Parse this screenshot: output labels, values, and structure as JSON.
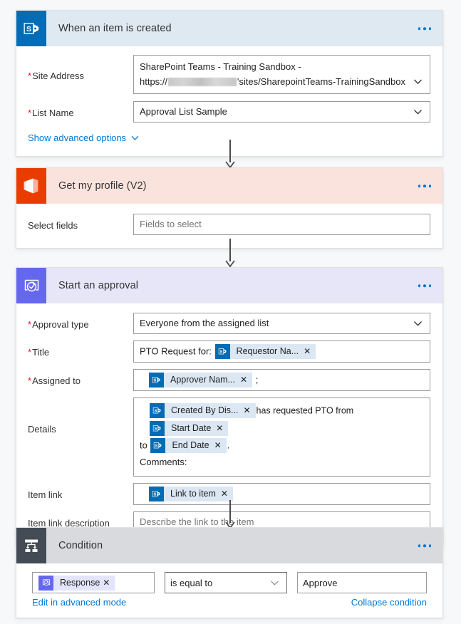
{
  "flow": {
    "steps": [
      {
        "id": "trigger-sharepoint",
        "title": "When an item is created",
        "connector": "SharePoint",
        "icon": "sharepoint-icon",
        "header_color": "#dfe9f2",
        "icon_color": "#036cb4",
        "menu": "more-options",
        "fields": [
          {
            "label": "Site Address",
            "required": true,
            "type": "dropdown",
            "value_line1": "SharePoint Teams - Training Sandbox -",
            "value_line2_prefix": "https://",
            "value_line2_redacted": true,
            "value_line2_suffix": "'sites/SharepointTeams-TrainingSandbox"
          },
          {
            "label": "List Name",
            "required": true,
            "type": "dropdown",
            "value": "Approval List Sample"
          }
        ],
        "advanced_link": "Show advanced options"
      },
      {
        "id": "get-my-profile",
        "title": "Get my profile (V2)",
        "connector": "Office 365 Users",
        "icon": "office365-icon",
        "header_color": "#fbe3dd",
        "icon_color": "#eb3c00",
        "menu": "more-options",
        "fields": [
          {
            "label": "Select fields",
            "required": false,
            "type": "text",
            "placeholder": "Fields to select",
            "value": ""
          }
        ]
      },
      {
        "id": "start-an-approval",
        "title": "Start an approval",
        "connector": "Approvals",
        "icon": "approvals-icon",
        "header_color": "#e6e6f8",
        "icon_color": "#6568ee",
        "menu": "more-options",
        "fields": [
          {
            "label": "Approval type",
            "required": true,
            "type": "dropdown",
            "value": "Everyone from the assigned list"
          },
          {
            "label": "Title",
            "required": true,
            "type": "tokens",
            "parts": [
              {
                "kind": "text",
                "text": "PTO Request for:"
              },
              {
                "kind": "token",
                "text": "Requestor Na...",
                "icon": "sharepoint-icon"
              }
            ]
          },
          {
            "label": "Assigned to",
            "required": true,
            "type": "tokens",
            "parts": [
              {
                "kind": "token",
                "text": "Approver Nam...",
                "icon": "sharepoint-icon"
              },
              {
                "kind": "text",
                "text": ";"
              }
            ]
          },
          {
            "label": "Details",
            "required": false,
            "type": "tokens",
            "parts": [
              {
                "kind": "token",
                "text": "Created By Dis...",
                "icon": "sharepoint-icon"
              },
              {
                "kind": "text",
                "text": "has requested PTO from"
              },
              {
                "kind": "token",
                "text": "Start Date",
                "icon": "sharepoint-icon"
              },
              {
                "kind": "break"
              },
              {
                "kind": "text",
                "text": "to"
              },
              {
                "kind": "token",
                "text": "End Date",
                "icon": "sharepoint-icon"
              },
              {
                "kind": "text",
                "text": "."
              },
              {
                "kind": "break"
              },
              {
                "kind": "text",
                "text": "Comments:"
              }
            ]
          },
          {
            "label": "Item link",
            "required": false,
            "type": "tokens",
            "parts": [
              {
                "kind": "token",
                "text": "Link to item",
                "icon": "sharepoint-icon"
              }
            ]
          },
          {
            "label": "Item link description",
            "required": false,
            "type": "text",
            "placeholder": "Describe the link to the item",
            "value": ""
          }
        ]
      },
      {
        "id": "condition",
        "title": "Condition",
        "connector": "Control",
        "icon": "condition-icon",
        "header_color": "#d8dadd",
        "icon_color": "#434b54",
        "menu": "more-options",
        "condition": {
          "left_token": {
            "text": "Response",
            "icon": "approvals-icon"
          },
          "operator": "is equal to",
          "right_value": "Approve",
          "advanced_link": "Edit in advanced mode",
          "collapse_link": "Collapse condition"
        }
      }
    ]
  },
  "icon_glyphs": {
    "sharepoint-icon": "S",
    "office365-icon": "O",
    "approvals-icon": "check-in-circle-arrow",
    "condition-icon": "branch-fork",
    "chevron-down-icon": "v",
    "close-icon": "×"
  },
  "colors": {
    "accent_link": "#0078d4",
    "required_asterisk": "#e81123",
    "canvas_background": "#f7f8f9",
    "token_chip": "#dbe7f3",
    "token_chip_lavender": "#e4e4fb",
    "arrow": "#4a4a4a"
  }
}
